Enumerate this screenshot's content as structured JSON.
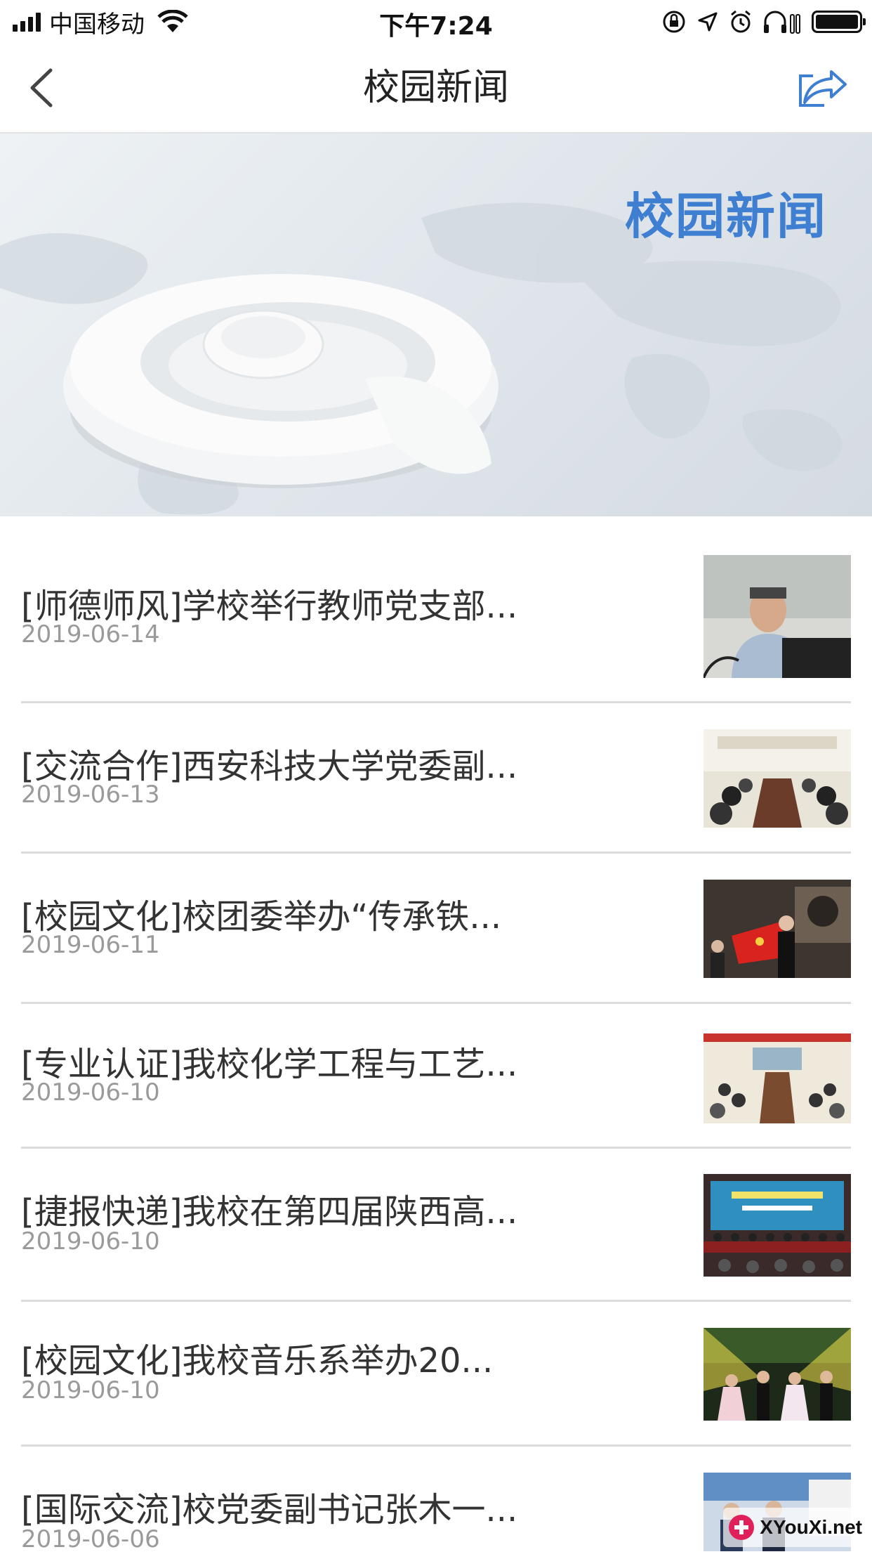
{
  "status_bar": {
    "carrier": "中国移动",
    "time": "下午7:24"
  },
  "nav": {
    "title": "校园新闻",
    "back_icon": "chevron-left-icon",
    "share_icon": "share-icon"
  },
  "banner": {
    "title": "校园新闻"
  },
  "news": [
    {
      "headline": "[师德师风]学校举行教师党支部...",
      "date": "2019-06-14"
    },
    {
      "headline": "[交流合作]西安科技大学党委副...",
      "date": "2019-06-13"
    },
    {
      "headline": "[校园文化]校团委举办“传承铁...",
      "date": "2019-06-11"
    },
    {
      "headline": "[专业认证]我校化学工程与工艺...",
      "date": "2019-06-10"
    },
    {
      "headline": "[捷报快递]我校在第四届陕西高...",
      "date": "2019-06-10"
    },
    {
      "headline": "[校园文化]我校音乐系举办20...",
      "date": "2019-06-10"
    },
    {
      "headline": "[国际交流]校党委副书记张木一...",
      "date": "2019-06-06"
    }
  ],
  "watermark": {
    "text": "XYouXi.net"
  },
  "colors": {
    "accent": "#3f7fd1",
    "text": "#333333",
    "date": "#9a9a9a",
    "divider": "#dcdcdc"
  }
}
